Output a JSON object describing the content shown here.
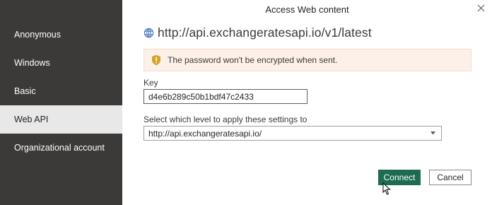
{
  "dialog": {
    "title": "Access Web content",
    "url": "http://api.exchangeratesapi.io/v1/latest",
    "warning": "The password won't be encrypted when sent."
  },
  "sidebar": {
    "items": [
      {
        "label": "Anonymous"
      },
      {
        "label": "Windows"
      },
      {
        "label": "Basic"
      },
      {
        "label": "Web API",
        "selected": true
      },
      {
        "label": "Organizational account"
      }
    ]
  },
  "form": {
    "key_label": "Key",
    "key_value": "d4e6b289c50b1bdf47c2433",
    "level_label": "Select which level to apply these settings to",
    "level_value": "http://api.exchangeratesapi.io/"
  },
  "buttons": {
    "connect": "Connect",
    "cancel": "Cancel"
  },
  "icons": {
    "globe": "globe-icon",
    "warning": "warning-shield-icon",
    "close": "close-icon",
    "caret": "chevron-down-icon"
  },
  "colors": {
    "sidebar_bg": "#3b3a39",
    "sidebar_selected_bg": "#e8e8e8",
    "accent": "#1e6b52",
    "warning_bg": "#fdf0e8",
    "warning_icon": "#c7a21a"
  }
}
